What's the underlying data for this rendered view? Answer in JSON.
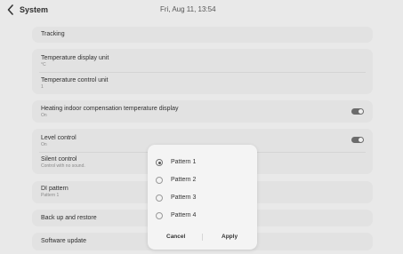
{
  "header": {
    "title": "System",
    "datetime": "Fri, Aug 11, 13:54"
  },
  "settings": {
    "tracking": "Tracking",
    "temp_display_unit": {
      "title": "Temperature display unit",
      "value": "°C"
    },
    "temp_control_unit": {
      "title": "Temperature control unit",
      "value": "1"
    },
    "heating_comp": {
      "title": "Heating indoor compensation temperature display",
      "value": "On",
      "enabled": true
    },
    "level_control": {
      "title": "Level control",
      "value": "On",
      "enabled": true
    },
    "silent_control": {
      "title": "Silent control",
      "value": "Control with no sound."
    },
    "di_pattern": {
      "title": "DI pattern",
      "value": "Pattern 1"
    },
    "backup": "Back up and restore",
    "software_update": "Software update"
  },
  "dialog": {
    "options": [
      "Pattern 1",
      "Pattern 2",
      "Pattern 3",
      "Pattern 4"
    ],
    "selected_index": 0,
    "cancel_label": "Cancel",
    "apply_label": "Apply"
  }
}
